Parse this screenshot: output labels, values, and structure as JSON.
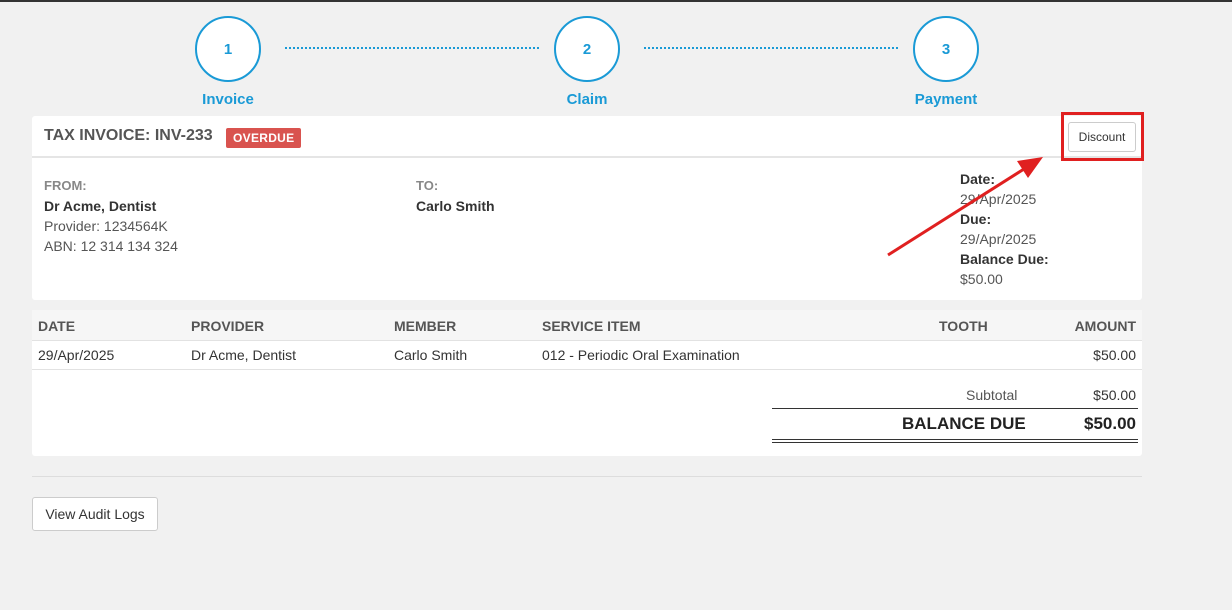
{
  "stepper": [
    {
      "number": "1",
      "label": "Invoice"
    },
    {
      "number": "2",
      "label": "Claim"
    },
    {
      "number": "3",
      "label": "Payment"
    }
  ],
  "invoice": {
    "title": "TAX INVOICE: INV-233",
    "status": "OVERDUE",
    "discount_label": "Discount",
    "from_label": "FROM:",
    "from_name": "Dr Acme, Dentist",
    "from_provider": "Provider: 1234564K",
    "from_abn": "ABN: 12 314 134 324",
    "to_label": "TO:",
    "to_name": "Carlo Smith",
    "date_label": "Date:",
    "date_value": "29/Apr/2025",
    "due_label": "Due:",
    "due_value": "29/Apr/2025",
    "balance_due_label": "Balance Due:",
    "balance_due_value": "$50.00"
  },
  "table": {
    "headers": [
      "DATE",
      "PROVIDER",
      "MEMBER",
      "SERVICE ITEM",
      "TOOTH",
      "AMOUNT"
    ],
    "rows": [
      [
        "29/Apr/2025",
        "Dr Acme, Dentist",
        "Carlo Smith",
        "012 - Periodic Oral Examination",
        "",
        "$50.00"
      ]
    ],
    "subtotal_label": "Subtotal",
    "subtotal_value": "$50.00",
    "balance_label": "BALANCE DUE",
    "balance_value": "$50.00"
  },
  "audit_button": "View Audit Logs",
  "colors": {
    "accent": "#1a9ad6",
    "overdue": "#d9534f",
    "annotation": "#e02020"
  }
}
